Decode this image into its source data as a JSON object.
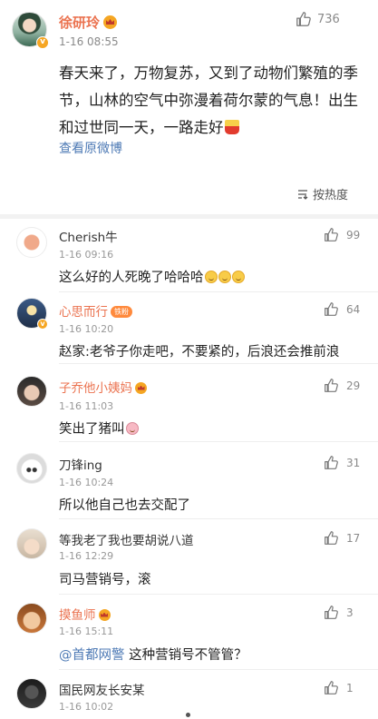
{
  "post": {
    "author": "徐研玲",
    "time": "1-16 08:55",
    "likes": "736",
    "text": "春天来了，万物复苏，又到了动物们繁殖的季节，山林的空气中弥漫着荷尔蒙的气息！出生和过世同一天，一路走好",
    "view_original": "查看原微博",
    "sort_label": "按热度"
  },
  "comments": [
    {
      "name": "Cherish牛",
      "time": "1-16 09:16",
      "text": "这么好的人死晚了哈哈哈",
      "likes": "99",
      "emoji": "smile x3"
    },
    {
      "name": "心思而行",
      "badge": "铁粉",
      "time": "1-16 10:20",
      "text": "赵家:老爷子你走吧，不要紧的，后浪还会推前浪",
      "likes": "64"
    },
    {
      "name": "子乔他小姨妈",
      "time": "1-16 11:03",
      "text": "笑出了猪叫",
      "likes": "29",
      "emoji": "pig"
    },
    {
      "name": "刀锋ing",
      "time": "1-16 10:24",
      "text": "所以他自己也去交配了",
      "likes": "31"
    },
    {
      "name": "等我老了我也要胡说八道",
      "time": "1-16 12:29",
      "text": "司马营销号，滚",
      "likes": "17"
    },
    {
      "name": "摸鱼师",
      "time": "1-16 15:11",
      "mention": "@首都网警",
      "text": " 这种营销号不管管？",
      "likes": "3"
    },
    {
      "name": "国民网友长安某",
      "time": "1-16 10:02",
      "likes": "1"
    }
  ],
  "colors": {
    "vip_name": "#eb7350",
    "link": "#4e7ab5",
    "muted": "#999999"
  },
  "icons": [
    "like-thumb-icon",
    "sort-icon",
    "verified-badge-icon",
    "vip-crown-icon"
  ]
}
